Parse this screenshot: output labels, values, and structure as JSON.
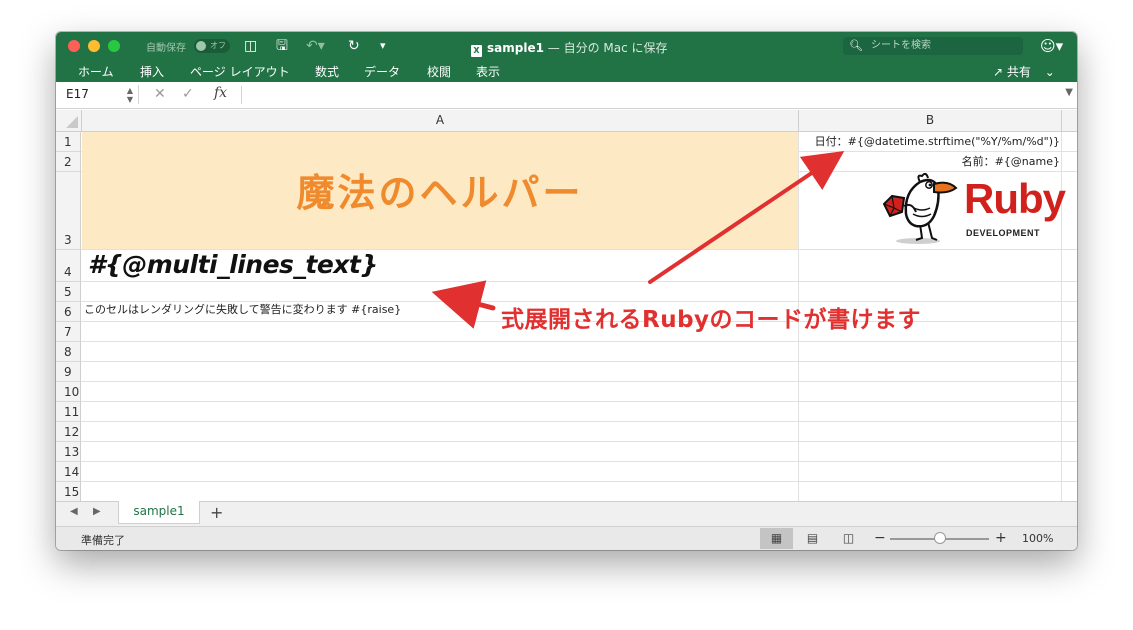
{
  "window": {
    "autosave_label": "自動保存",
    "autosave_state": "オフ",
    "file_name": "sample1",
    "title_suffix": " — 自分の Mac に保存",
    "search_placeholder": "シートを検索"
  },
  "ribbon": {
    "tabs": [
      "ホーム",
      "挿入",
      "ページ レイアウト",
      "数式",
      "データ",
      "校閲",
      "表示"
    ],
    "share_label": "共有"
  },
  "formula_bar": {
    "name_box": "E17",
    "fx_label": "fx",
    "content": ""
  },
  "grid": {
    "columns": [
      "A",
      "B"
    ],
    "rows": [
      "1",
      "2",
      "3",
      "4",
      "5",
      "6",
      "7",
      "8",
      "9",
      "10",
      "11",
      "12",
      "13",
      "14",
      "15"
    ],
    "cells": {
      "A1_banner": "魔法のヘルパー",
      "B1": "日付：#{@datetime.strftime(\"%Y/%m/%d\")}",
      "B2": "名前：#{@name}",
      "A4": "#{@multi_lines_text}",
      "A6": "このセルはレンダリングに失敗して警告に変わります #{raise}"
    },
    "logo": {
      "word": "Ruby",
      "tagline": "DEVELOPMENT"
    },
    "annotation": "式展開されるRubyのコードが書けます"
  },
  "sheets": {
    "tabs": [
      "sample1"
    ],
    "active": "sample1"
  },
  "status": {
    "text": "準備完了",
    "zoom": "100%"
  },
  "colors": {
    "excel_green": "#217346",
    "banner_fill": "#fde9c4",
    "banner_text": "#ef8a2d",
    "annotation_red": "#e03030",
    "ruby_red": "#d0211c"
  }
}
